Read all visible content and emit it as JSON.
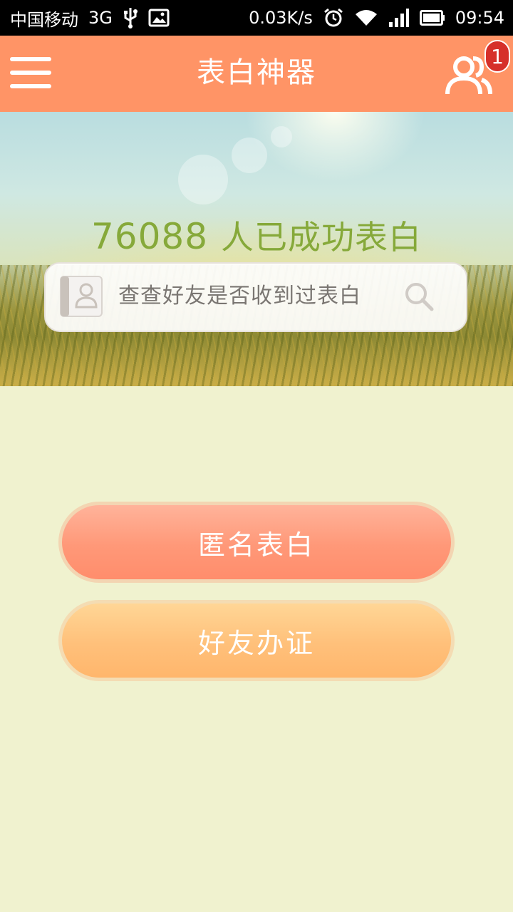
{
  "status_bar": {
    "carrier": "中国移动",
    "network": "3G",
    "speed": "0.03K/s",
    "time": "09:54",
    "icons": [
      "usb-icon",
      "image-icon",
      "alarm-icon",
      "wifi-icon",
      "signal-icon",
      "battery-icon"
    ]
  },
  "app_bar": {
    "title": "表白神器",
    "menu_icon": "hamburger-menu-icon",
    "friends_icon": "users-icon",
    "badge_count": "1"
  },
  "hero": {
    "count": "76088",
    "count_suffix": "人已成功表白",
    "search_placeholder": "查查好友是否收到过表白"
  },
  "actions": {
    "anonymous_confession": "匿名表白",
    "friend_certificate": "好友办证"
  },
  "colors": {
    "app_bar": "#ff9466",
    "background": "#f0f2cf",
    "counter_text": "#86a93a",
    "confess_button": "#ff9878",
    "certificate_button": "#ffc07a",
    "badge": "#d6302a"
  }
}
